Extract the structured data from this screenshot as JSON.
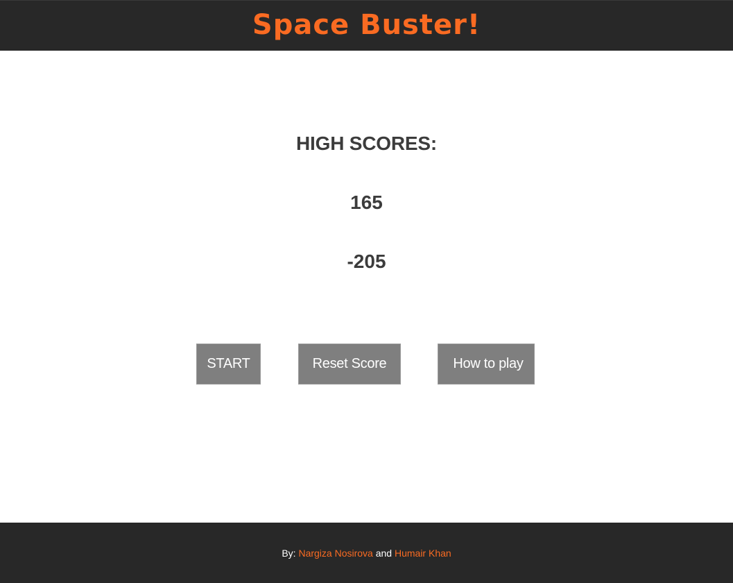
{
  "header": {
    "title": "Space Buster!"
  },
  "scores": {
    "heading": "HIGH SCORES:",
    "values": [
      "165",
      "-205"
    ]
  },
  "buttons": {
    "start": "START",
    "reset": "Reset Score",
    "howto": "How to play"
  },
  "footer": {
    "by": "By: ",
    "author1": "Nargiza Nosirova",
    "and": " and ",
    "author2": "Humair Khan"
  },
  "colors": {
    "accent": "#fa6b22",
    "bar": "#282828",
    "button": "#7f7f7f",
    "text": "#3c3c3c"
  }
}
